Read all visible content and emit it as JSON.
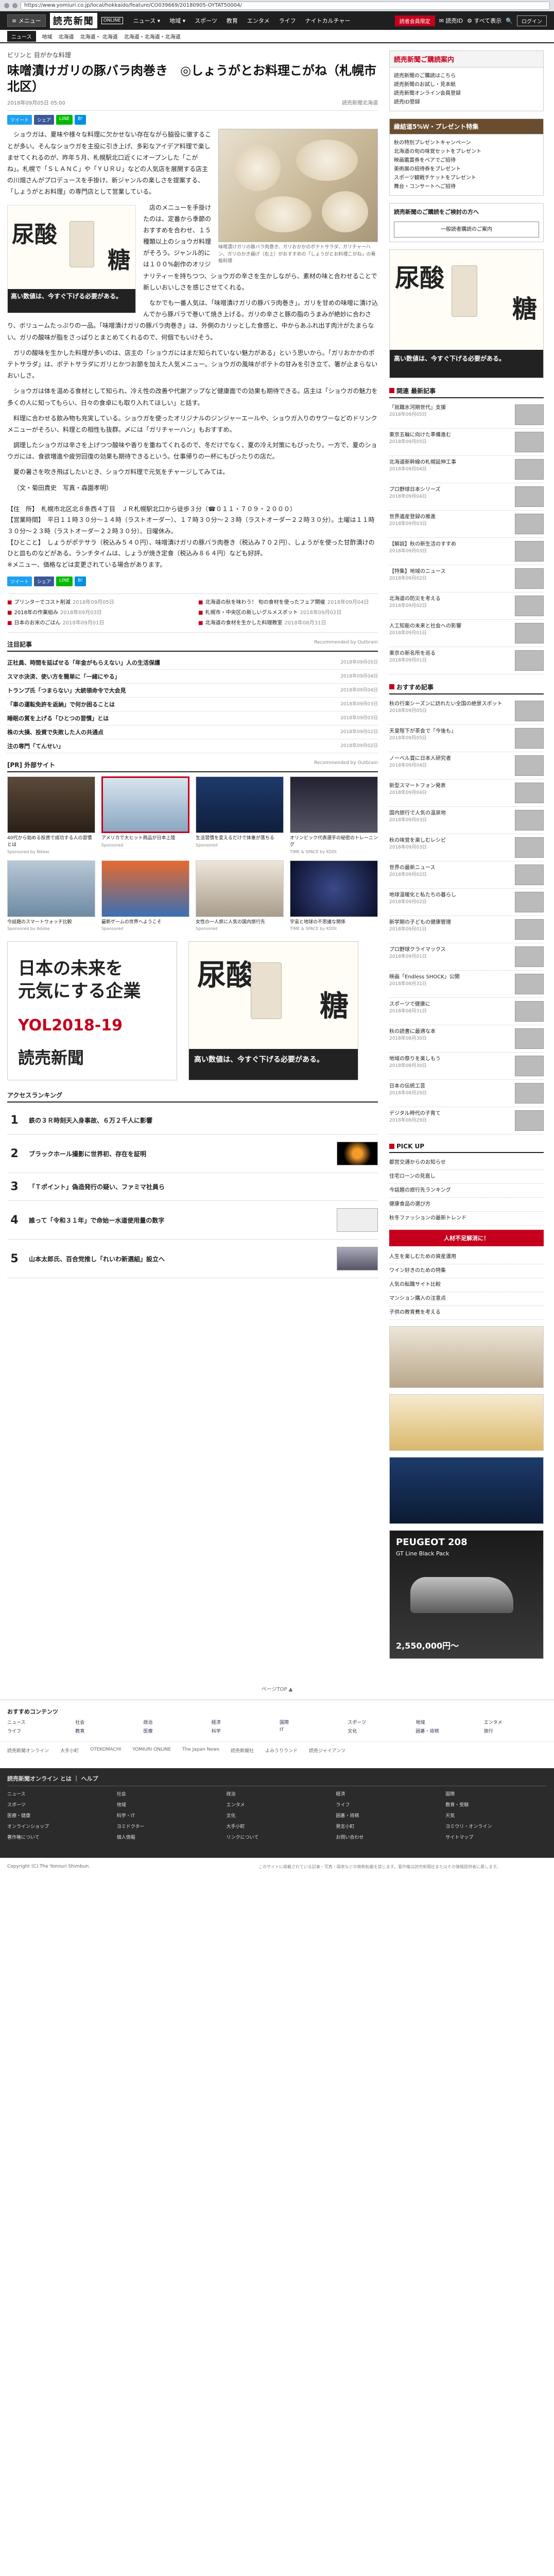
{
  "browser": {
    "url": "https://www.yomiuri.co.jp/local/hokkaido/feature/CO039669/20180905-OYTAT50004/"
  },
  "topnav": {
    "logo": "読売新聞",
    "badge": "ONLINE",
    "menu_label": "≡ メニュー",
    "links": [
      "ニュース ▾",
      "地域 ▾",
      "スポーツ",
      "教育",
      "エンタメ",
      "ライフ",
      "ナイトカルチャー"
    ],
    "right": [
      "✉ 読売ID",
      "⚙ すべて表示",
      "🔍",
      "ログイン"
    ],
    "register": "読者会員限定"
  },
  "subnav": {
    "active": "ニュース",
    "crumbs": [
      "地域",
      "北海道",
      "北海道・ 北海道",
      "北海道・北海道・北海道"
    ]
  },
  "article": {
    "category": "ビリンと 目がかな料理",
    "title": "味噌漬けガリの豚バラ肉巻き　◎しょうがとお料理こがね（札幌市北区）",
    "date": "2018年09月05日 05:00",
    "byline": "読売新聞北海道",
    "share": [
      "ツイート",
      "シェア",
      "LINE",
      "B!"
    ],
    "caption": "味噌漬けガリの豚バラ肉巻き、ガリおかかのポテトサラダ、ガリチャーハン、ガリのかき揚げ（右上）がおすすめの「しょうがとお料理こがね」の看板料理",
    "paragraphs": [
      "ショウガは、夏味や様々な料理に欠かせない存在ながら脇役に徹することが多い。そんなショウガを主役に引き上げ、多彩なアイデア料理で楽しませてくれるのが、昨年５月、札幌駅北口近くにオープンした「こがね」。札幌で「ＳＬＡＮＣ」や「ＹＵＲＵ」などの人気店を展開する店主の川畑さんがプロデュースを手掛け、新ジャンルの楽しさを提案する、「しょうがとお料理」の専門店として営業している。",
      "店のメニューを手掛けたのは、定番から季節のおすすめを合わせ、１５種類以上のショウガ料理がそろう。ジャンル的には１００%創作のオリジナリティーを持ちつつ、ショウガの辛さを生かしながら、素材の味と合わせることで新しいおいしさを感じさせてくれる。",
      "なかでも一番人気は、「味噌漬けガリの豚バラ肉巻き」。ガリを甘めの味噌に漬け込んでから豚バラで巻いて焼き上げる。ガリの辛さと豚の脂のうまみが絶妙に合わさり、ボリュームたっぷりの一品。「味噌漬けガリの豚バラ肉巻き」は、外側のカリッとした食感と、中からあふれ出す肉汁がたまらない。ガリの酸味が脂をさっぱりとまとめてくれるので、何個でもいけそう。",
      "ガリの酸味を生かした料理が多いのは、店主の「ショウガにはまだ知られていない魅力がある」という思いから。「ガリおかかのポテトサラダ」は、ポテトサラダにガリとかつお節を加えた人気メニュー。ショウガの風味がポテトの甘みを引き立て、箸が止まらないおいしさ。",
      "ショウガは体を温める食材として知られ、冷え性の改善や代謝アップなど健康面での効果も期待できる。店主は「ショウガの魅力を多くの人に知ってもらい、日々の食卓にも取り入れてほしい」と話す。",
      "料理に合わせる飲み物も充実している。ショウガを使ったオリジナルのジンジャーエールや、ショウガ入りのサワーなどのドリンクメニューがそろい、料理との相性も抜群。〆には「ガリチャーハン」もおすすめ。",
      "調理したショウガは辛さを上げつつ酸味や香りを重ねてくれるので、冬だけでなく、夏の冷え対策にもぴったり。一方で、夏のショウガには、食欲増進や疲労回復の効果も期待できるという。仕事帰りの一杯にもぴったりの店だ。",
      "夏の暑さを吹き飛ばしたいとき、ショウガ料理で元気をチャージしてみては。",
      "（文・菊田貴史　写真・森園孝明）"
    ],
    "info": [
      "【住　所】　札幌市北区北８条西４丁目　ＪＲ札幌駅北口から徒歩３分（☎０１１・７０９・２０００）",
      "【営業時間】　平日１１時３０分～１４時（ラストオーダー）、１７時３０分～２３時（ラストオーダー２２時３０分）。土曜は１１時３０分～２３時（ラストオーダー２２時３０分）、日曜休み。",
      "【ひとこと】　しょうがポテサラ（税込み５４０円）、味噌漬けガリの豚バラ肉巻き（税込み７０２円）、しょうがを使った甘酢漬けのひと皿ものなどがある。ランチタイムは、しょうが焼き定食（税込み８６４円）なども好評。",
      "※メニュー、価格などは変更されている場合があります。"
    ],
    "related": [
      {
        "text": "プリンターでコスト削減",
        "date": "2018年09月05日"
      },
      {
        "text": "北海道の秋を味わう！ 旬の食材を使ったフェア開催",
        "date": "2018年09月04日"
      },
      {
        "text": "2018年の作業組み",
        "date": "2018年09月03日"
      },
      {
        "text": "札幌市・中央区の新しいグルメスポット",
        "date": "2018年09月02日"
      },
      {
        "text": "日本のお米のごはん",
        "date": "2018年09月01日"
      },
      {
        "text": "北海道の食材を生かした料理教室",
        "date": "2018年08月31日"
      }
    ]
  },
  "inline_ad": {
    "word1": "尿酸",
    "word2": "糖",
    "tagline": "高い数値は、今すぐ下げる必要がある。"
  },
  "latest": {
    "title": "注目記事",
    "sub": "Recommended by Outbrain",
    "rows": [
      {
        "t": "正社員、時間を延ばせる「年金がもらえない」人の生活保護",
        "d": "2018年09月05日"
      },
      {
        "t": "スマホ決済、使い方を簡単に「一緒にやる」",
        "d": "2018年09月04日"
      },
      {
        "t": "トランプ氏「つまらない」大統領命令で大会見",
        "d": "2018年09月04日"
      },
      {
        "t": "「車の運転免許を返納」で何か困ることは",
        "d": "2018年09月03日"
      },
      {
        "t": "睡眠の質を上げる「ひとつの習慣」とは",
        "d": "2018年09月03日"
      },
      {
        "t": "株の大損、投資で失敗した人の共通点",
        "d": "2018年09月02日"
      },
      {
        "t": "注の専門「てんせい」",
        "d": "2018年09月02日"
      }
    ]
  },
  "pr": {
    "title": "[PR] 外部サイト",
    "sub": "Recommended by Outbrain",
    "cards": [
      {
        "t": "40代から始める投資で成功する人の習慣とは",
        "s": "Sponsored by Nikkei"
      },
      {
        "t": "アメリカで大ヒット商品が日本上陸",
        "s": "Sponsored"
      },
      {
        "t": "生活習慣を変えるだけで体重が落ちる",
        "s": "Sponsored"
      },
      {
        "t": "オリンピック代表選手の秘密のトレーニング",
        "s": "TIME & SPACE by KDDI"
      },
      {
        "t": "今話題のスマートウォッチ比較",
        "s": "Sponsored by Adobe"
      },
      {
        "t": "最新ゲームの世界へようこそ",
        "s": "Sponsored"
      },
      {
        "t": "女性の一人旅に人気の国内旅行先",
        "s": "Sponsored"
      },
      {
        "t": "宇宙と地球の不思議な関係",
        "s": "TIME & SPACE by KDDI"
      }
    ]
  },
  "big_ads": {
    "left_line1": "日本の未来を",
    "left_line2": "元気にする企業",
    "left_line3": "YOL2018-19",
    "left_logo": "読売新聞",
    "right_word1": "尿酸",
    "right_word2": "糖",
    "right_tag": "高い数値は、今すぐ下げる必要がある。"
  },
  "ranking": {
    "title": "アクセスランキング",
    "items": [
      {
        "n": "1",
        "t": "鉄の３Ｒ時刻天入身事故、６万２千人に影響"
      },
      {
        "n": "2",
        "t": "ブラックホール撮影に世界初、存在を証明"
      },
      {
        "n": "3",
        "t": "「Ｔポイント」偽造発行の疑い、ファミマ社員ら"
      },
      {
        "n": "4",
        "t": "誰って「令和３１年」で命始ー水道使用量の数字"
      },
      {
        "n": "5",
        "t": "山本太郎氏、百合党推し「れいわ新選組」設立へ"
      }
    ]
  },
  "side": {
    "register_title": "読売新聞ご購読案内",
    "register_items": [
      "読売新聞のご購読はこちら",
      "読売新聞のお試し・見本紙",
      "読売新聞オンライン会員登録",
      "読売ID登録"
    ],
    "weekly_title": "縁結道5%Ｗ・プレゼント特集",
    "weekly_items": [
      "秋の特別プレゼントキャンペーン",
      "北海道の旬の味覚セットをプレゼント",
      "映画鑑賞券をペアでご招待",
      "美術展の招待券をプレゼント",
      "スポーツ観戦チケットをプレゼント",
      "舞台・コンサートへご招待"
    ],
    "search_title": "読売新聞のご購読をご検討の方へ",
    "search_btn": "一般読者購読のご案内",
    "ad_word1": "尿酸",
    "ad_word2": "糖",
    "ad_tag": "高い数値は、今すぐ下げる必要がある。",
    "news_title": "関連 最新記事",
    "news": [
      {
        "t": "「就職氷河期世代」支援",
        "d": "2018年09月05日"
      },
      {
        "t": "東京五輪に向けた準備進む",
        "d": "2018年09月05日"
      },
      {
        "t": "北海道新幹線の札幌延伸工事",
        "d": "2018年09月04日"
      },
      {
        "t": "プロ野球日本シリーズ",
        "d": "2018年09月04日"
      },
      {
        "t": "世界遺産登録の推進",
        "d": "2018年09月03日"
      },
      {
        "t": "【解説】秋の新生活のすすめ",
        "d": "2018年09月03日"
      },
      {
        "t": "【特集】地域のニュース",
        "d": "2018年09月02日"
      },
      {
        "t": "北海道の防災を考える",
        "d": "2018年09月02日"
      },
      {
        "t": "人工知能の未来と社会への影響",
        "d": "2018年09月01日"
      },
      {
        "t": "東京の新名所を巡る",
        "d": "2018年09月01日"
      }
    ],
    "pick_title": "おすすめ記事",
    "picks": [
      {
        "t": "秋の行楽シーズンに訪れたい全国の絶景スポット",
        "d": "2018年09月05日"
      },
      {
        "t": "天皇陛下が茶会で「今後も」",
        "d": "2018年09月05日"
      },
      {
        "t": "ノーベル賞に日本人研究者",
        "d": "2018年09月04日"
      },
      {
        "t": "新型スマートフォン発表",
        "d": "2018年09月04日"
      },
      {
        "t": "国内旅行で人気の温泉地",
        "d": "2018年09月03日"
      },
      {
        "t": "秋の味覚を楽しむレシピ",
        "d": "2018年09月03日"
      },
      {
        "t": "世界の最新ニュース",
        "d": "2018年09月02日"
      },
      {
        "t": "地球温暖化と私たちの暮らし",
        "d": "2018年09月02日"
      },
      {
        "t": "新学期の子どもの健康管理",
        "d": "2018年09月01日"
      },
      {
        "t": "プロ野球クライマックス",
        "d": "2018年09月01日"
      },
      {
        "t": "映画「Endless SHOCK」公開",
        "d": "2018年08月31日"
      },
      {
        "t": "スポーツで健康に",
        "d": "2018年08月31日"
      },
      {
        "t": "秋の読書に最適な本",
        "d": "2018年08月30日"
      },
      {
        "t": "地域の祭りを楽しもう",
        "d": "2018年08月30日"
      },
      {
        "t": "日本の伝統工芸",
        "d": "2018年08月29日"
      },
      {
        "t": "デジタル時代の子育て",
        "d": "2018年08月29日"
      }
    ],
    "pickup_title": "PICK UP",
    "pickup": [
      "都営交通からのお知らせ",
      "住宅ローンの見直し",
      "今話題の旅行先ランキング",
      "健康食品の選び方",
      "秋冬ファッションの最新トレンド",
      "人生を楽しむための資産運用",
      "ワイン好きのための特集",
      "人気の転職サイト比較",
      "マンション購入の注意点",
      "子供の教育費を考える"
    ],
    "red_pill": "人材不足解消に！",
    "peugeot_title": "PEUGEOT 208",
    "peugeot_sub": "GT Line Black Pack",
    "peugeot_price": "2,550,000円〜"
  },
  "pager": "ページTOP ▲",
  "footer_menu": {
    "title": "おすすめコンテンツ",
    "cols": [
      "ニュース",
      "社会",
      "政治",
      "経済",
      "国際",
      "スポーツ",
      "地域",
      "エンタメ",
      "ライフ",
      "教育",
      "医療",
      "科学",
      "IT",
      "文化",
      "囲碁・将棋",
      "旅行"
    ]
  },
  "partners": [
    "読売新聞オンライン",
    "大手小町",
    "OTEKOMACHI",
    "YOMIURI ONLINE",
    "The Japan News",
    "読売新聞社",
    "よみうりランド",
    "読売ジャイアンツ"
  ],
  "dark_footer": {
    "title": "読売新聞オンライン とは ｜ ヘルプ",
    "cols": [
      "ニュース",
      "社会",
      "政治",
      "経済",
      "国際",
      "スポーツ",
      "地域",
      "エンタメ",
      "ライフ",
      "教育・受験",
      "医療・健康",
      "科学・IT",
      "文化",
      "囲碁・将棋",
      "天気",
      "オンラインショップ",
      "ヨミドクター",
      "大手小町",
      "発言小町",
      "ヨミウリ・オンライン",
      "著作権について",
      "個人情報",
      "リンクについて",
      "お問い合わせ",
      "サイトマップ"
    ]
  },
  "copyright": "Copyright (C) The Yomiuri Shimbun.",
  "copyright_note": "このサイトに掲載されている記事・写真・図表などの無断転載を禁じます。著作権は読売新聞社またはその情報提供者に属します。"
}
